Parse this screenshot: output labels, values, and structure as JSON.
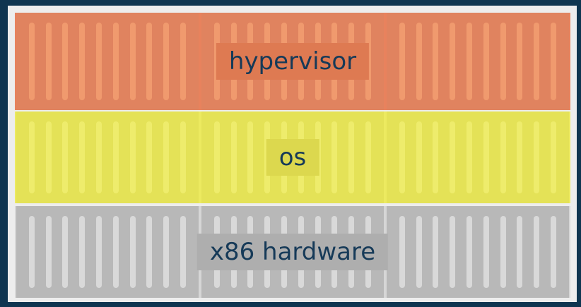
{
  "diagram": {
    "layers": [
      {
        "id": "hypervisor",
        "label": "hypervisor",
        "colors": {
          "frame": "#e8825d",
          "block": "#e0835f",
          "slat": "#f09a6e",
          "label_bg": "#de7a52"
        }
      },
      {
        "id": "os",
        "label": "os",
        "colors": {
          "frame": "#ecea60",
          "block": "#e4e257",
          "slat": "#eeec6c",
          "label_bg": "#dcd84e"
        }
      },
      {
        "id": "x86-hardware",
        "label": "x86 hardware",
        "colors": {
          "frame": "#d6d6d6",
          "block": "#b8b8b8",
          "slat": "#d9d9d9",
          "label_bg": "#aeaeae"
        }
      }
    ]
  }
}
